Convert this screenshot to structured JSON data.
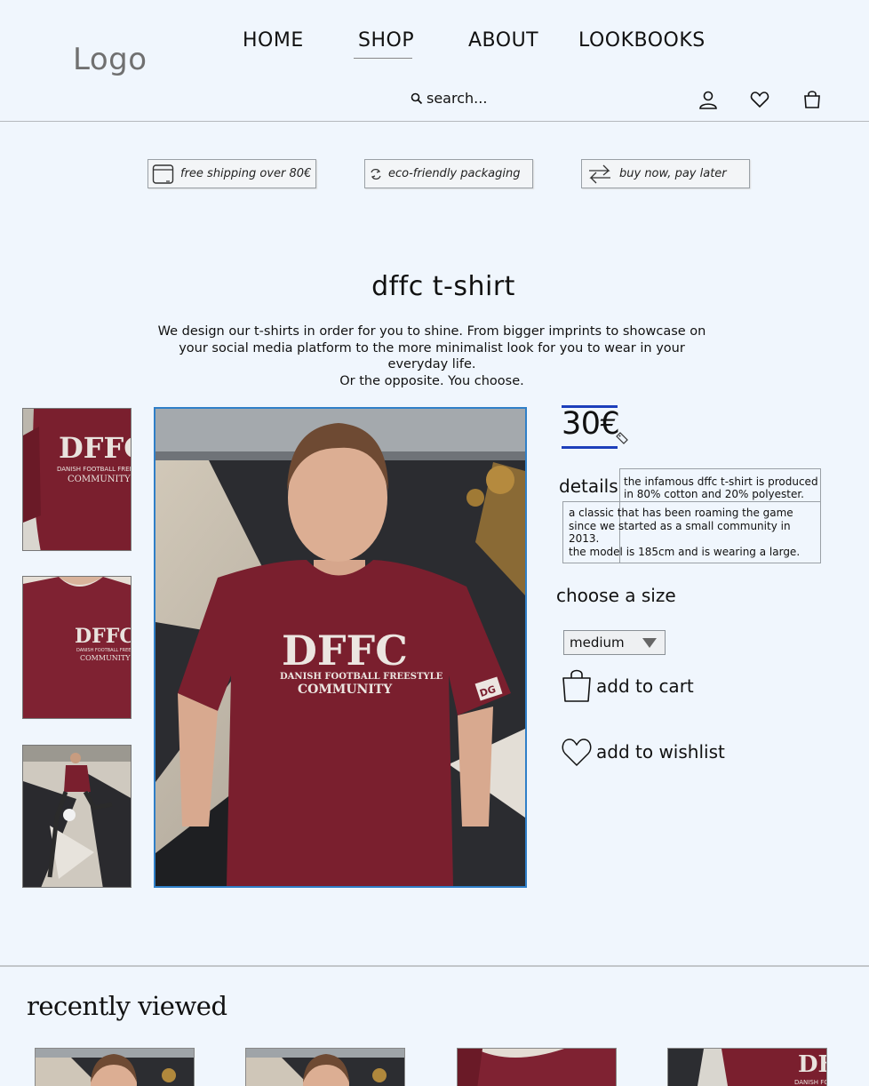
{
  "header": {
    "logo": "Logo",
    "nav": [
      "HOME",
      "SHOP",
      "ABOUT",
      "LOOKBOOKS"
    ],
    "active_nav": "SHOP",
    "search_placeholder": "search...",
    "icons": [
      "user-icon",
      "heart-icon",
      "bag-icon"
    ]
  },
  "perks": [
    {
      "label": "free shipping over 80€",
      "icon": "box-icon"
    },
    {
      "label": "eco-friendly packaging",
      "icon": "recycle-icon"
    },
    {
      "label": "buy now, pay later",
      "icon": "exchange-arrows-icon"
    }
  ],
  "product": {
    "title": "dffc t-shirt",
    "description": [
      "We design our t-shirts in order for you to shine. From bigger imprints to showcase on your social media platform to the more minimalist look for you to wear in your everyday life.",
      "Or the opposite. You choose."
    ],
    "price": "30€",
    "details_label": "details",
    "details_text_1": "the infamous dffc t-shirt is produced in 80% cotton and 20% polyester.",
    "details_text_2": "a classic that has been roaming the game since we started as a small community in 2013.",
    "details_text_3": "the model is 185cm and is wearing a large.",
    "size_label": "choose a size",
    "size_selected": "medium",
    "add_to_cart": "add to cart",
    "add_to_wishlist": "add to wishlist",
    "shirt_print_main": "DFFC",
    "shirt_print_sub": "DANISH FOOTBALL FREESTYLE",
    "shirt_print_community": "COMMUNITY",
    "sleeve_badge": "DG"
  },
  "recently_viewed": {
    "title": "recently viewed",
    "count": 4
  },
  "colors": {
    "background": "#f0f6fd",
    "shirt": "#7a1f2e",
    "price_accent": "#1d3fbb",
    "photo_border": "#2f7fc8"
  }
}
